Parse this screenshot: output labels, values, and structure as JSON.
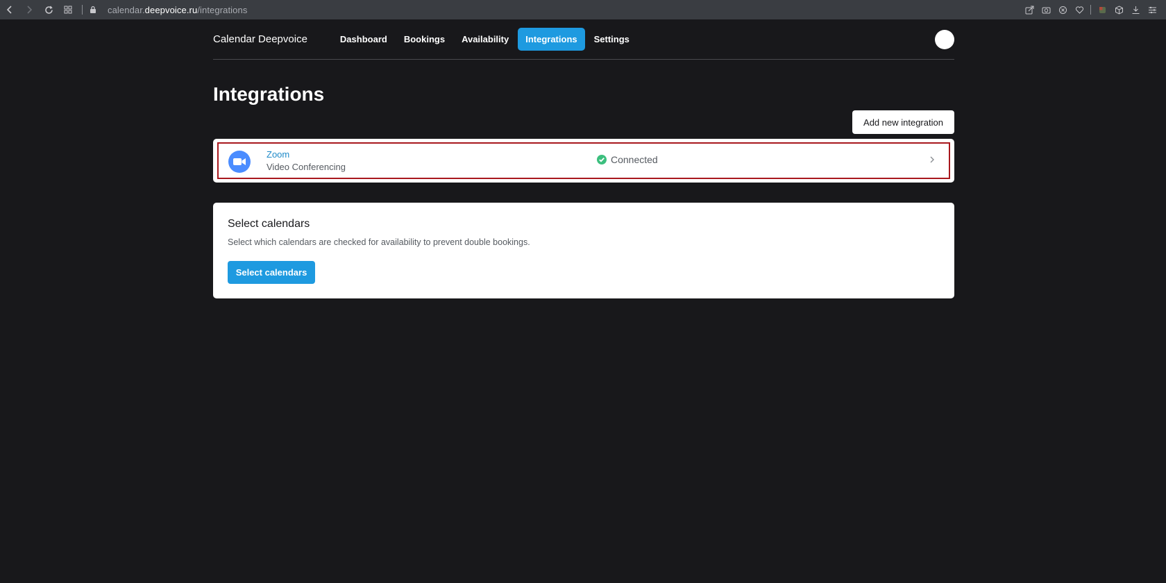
{
  "browser": {
    "url_prefix": "calendar.",
    "url_domain": "deepvoice.ru",
    "url_path": "/integrations"
  },
  "header": {
    "brand": "Calendar Deepvoice",
    "nav": [
      {
        "label": "Dashboard",
        "active": false
      },
      {
        "label": "Bookings",
        "active": false
      },
      {
        "label": "Availability",
        "active": false
      },
      {
        "label": "Integrations",
        "active": true
      },
      {
        "label": "Settings",
        "active": false
      }
    ]
  },
  "page": {
    "title": "Integrations",
    "add_button": "Add new integration"
  },
  "integration": {
    "name": "Zoom",
    "type": "Video Conferencing",
    "status": "Connected",
    "status_color": "#3cbf7e",
    "logo_color": "#4a8cff"
  },
  "calendars": {
    "title": "Select calendars",
    "description": "Select which calendars are checked for availability to prevent double bookings.",
    "button": "Select calendars"
  },
  "colors": {
    "accent": "#1e9ae0",
    "background": "#18181b",
    "highlight_border": "#a8181e"
  }
}
